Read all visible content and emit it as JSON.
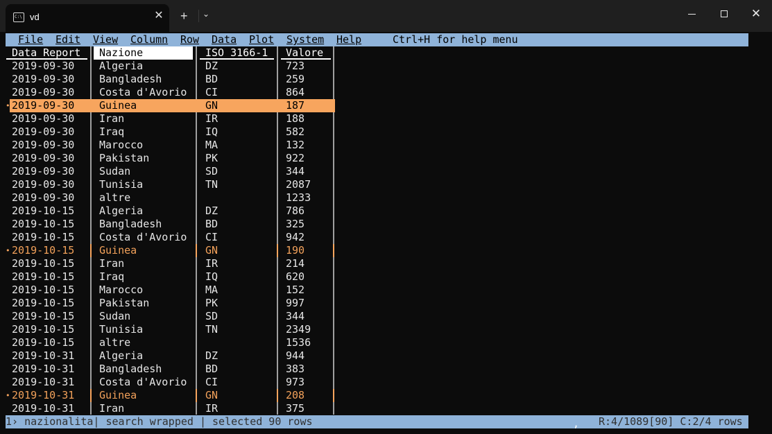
{
  "window": {
    "tab_title": "vd",
    "tab_icon": "terminal-icon",
    "new_tab_symbol": "+",
    "close_tab_symbol": "✕",
    "close_window_symbol": "✕"
  },
  "menu": {
    "items": [
      "File",
      "Edit",
      "View",
      "Column",
      "Row",
      "Data",
      "Plot",
      "System",
      "Help"
    ],
    "hint": "Ctrl+H for help menu"
  },
  "columns": [
    "Data_Report",
    "Nazione",
    "ISO_3166-1",
    "Valore"
  ],
  "rows": [
    {
      "date": "2019-09-30",
      "nation": "Algeria",
      "iso": "DZ",
      "value": "723",
      "state": "normal"
    },
    {
      "date": "2019-09-30",
      "nation": "Bangladesh",
      "iso": "BD",
      "value": "259",
      "state": "normal"
    },
    {
      "date": "2019-09-30",
      "nation": "Costa d'Avorio",
      "iso": "CI",
      "value": "864",
      "state": "normal"
    },
    {
      "date": "2019-09-30",
      "nation": "Guinea",
      "iso": "GN",
      "value": "187",
      "state": "cursor"
    },
    {
      "date": "2019-09-30",
      "nation": "Iran",
      "iso": "IR",
      "value": "188",
      "state": "normal"
    },
    {
      "date": "2019-09-30",
      "nation": "Iraq",
      "iso": "IQ",
      "value": "582",
      "state": "normal"
    },
    {
      "date": "2019-09-30",
      "nation": "Marocco",
      "iso": "MA",
      "value": "132",
      "state": "normal"
    },
    {
      "date": "2019-09-30",
      "nation": "Pakistan",
      "iso": "PK",
      "value": "922",
      "state": "normal"
    },
    {
      "date": "2019-09-30",
      "nation": "Sudan",
      "iso": "SD",
      "value": "344",
      "state": "normal"
    },
    {
      "date": "2019-09-30",
      "nation": "Tunisia",
      "iso": "TN",
      "value": "2087",
      "state": "normal"
    },
    {
      "date": "2019-09-30",
      "nation": "altre",
      "iso": "",
      "value": "1233",
      "state": "normal"
    },
    {
      "date": "2019-10-15",
      "nation": "Algeria",
      "iso": "DZ",
      "value": "786",
      "state": "normal"
    },
    {
      "date": "2019-10-15",
      "nation": "Bangladesh",
      "iso": "BD",
      "value": "325",
      "state": "normal"
    },
    {
      "date": "2019-10-15",
      "nation": "Costa d'Avorio",
      "iso": "CI",
      "value": "942",
      "state": "normal"
    },
    {
      "date": "2019-10-15",
      "nation": "Guinea",
      "iso": "GN",
      "value": "190",
      "state": "selected"
    },
    {
      "date": "2019-10-15",
      "nation": "Iran",
      "iso": "IR",
      "value": "214",
      "state": "normal"
    },
    {
      "date": "2019-10-15",
      "nation": "Iraq",
      "iso": "IQ",
      "value": "620",
      "state": "normal"
    },
    {
      "date": "2019-10-15",
      "nation": "Marocco",
      "iso": "MA",
      "value": "152",
      "state": "normal"
    },
    {
      "date": "2019-10-15",
      "nation": "Pakistan",
      "iso": "PK",
      "value": "997",
      "state": "normal"
    },
    {
      "date": "2019-10-15",
      "nation": "Sudan",
      "iso": "SD",
      "value": "344",
      "state": "normal"
    },
    {
      "date": "2019-10-15",
      "nation": "Tunisia",
      "iso": "TN",
      "value": "2349",
      "state": "normal"
    },
    {
      "date": "2019-10-15",
      "nation": "altre",
      "iso": "",
      "value": "1536",
      "state": "normal"
    },
    {
      "date": "2019-10-31",
      "nation": "Algeria",
      "iso": "DZ",
      "value": "944",
      "state": "normal"
    },
    {
      "date": "2019-10-31",
      "nation": "Bangladesh",
      "iso": "BD",
      "value": "383",
      "state": "normal"
    },
    {
      "date": "2019-10-31",
      "nation": "Costa d'Avorio",
      "iso": "CI",
      "value": "973",
      "state": "normal"
    },
    {
      "date": "2019-10-31",
      "nation": "Guinea",
      "iso": "GN",
      "value": "208",
      "state": "selected"
    },
    {
      "date": "2019-10-31",
      "nation": "Iran",
      "iso": "IR",
      "value": "375",
      "state": "normal"
    }
  ],
  "status": {
    "left": "1› nazionalita| search wrapped | selected 90 rows",
    "comma": ",",
    "right": "R:4/1089[90] C:2/4 rows"
  },
  "colors": {
    "menu_bg": "#8fb3d9",
    "selected_row": "#f2a15a",
    "cursor_row_bg": "#f7a55e"
  }
}
